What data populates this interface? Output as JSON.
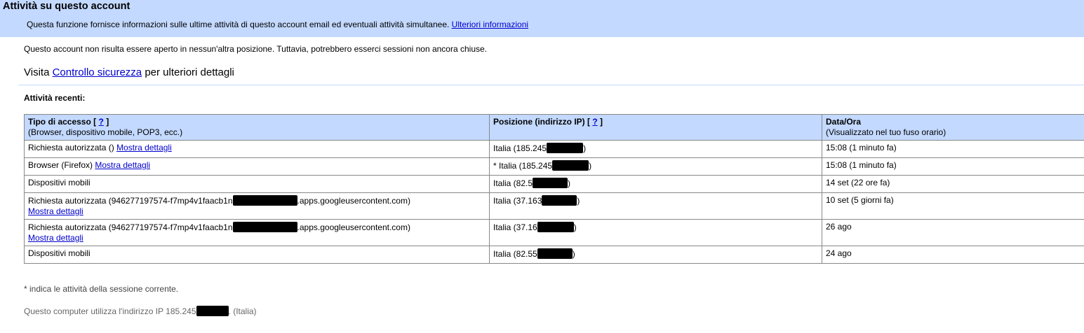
{
  "header": {
    "title": "Attività su questo account",
    "description": "Questa funzione fornisce informazioni sulle ultime attività di questo account email ed eventuali attività simultanee.",
    "more_info_link": "Ulteriori informazioni"
  },
  "notice": "Questo account non risulta essere aperto in nessun'altra posizione. Tuttavia, potrebbero esserci sessioni non ancora chiuse.",
  "visit": {
    "prefix": "Visita",
    "link": "Controllo sicurezza",
    "suffix": "per ulteriori dettagli"
  },
  "recent_heading": "Attività recenti:",
  "table": {
    "col_access": {
      "title": "Tipo di accesso [",
      "help": "?",
      "close": "]",
      "subtitle": "(Browser, dispositivo mobile, POP3, ecc.)"
    },
    "col_location": {
      "title": "Posizione (indirizzo IP) [",
      "help": "?",
      "close": "]"
    },
    "col_datetime": {
      "title": "Data/Ora",
      "subtitle": "(Visualizzato nel tuo fuso orario)"
    },
    "rows": [
      {
        "access_a": "Richiesta autorizzata ()",
        "access_b": "",
        "details_link": "Mostra dettagli",
        "location_prefix": "Italia (185.245",
        "location_suffix": ")",
        "datetime": "15:08 (1 minuto fa)"
      },
      {
        "access_a": "Browser (Firefox)",
        "access_b": "",
        "details_link": "Mostra dettagli",
        "location_prefix": "* Italia (185.245",
        "location_suffix": ")",
        "datetime": "15:08 (1 minuto fa)"
      },
      {
        "access_a": "Dispositivi mobili",
        "access_b": "",
        "details_link": "",
        "location_prefix": "Italia (82.5",
        "location_suffix": ")",
        "datetime": "14 set (22 ore fa)"
      },
      {
        "access_a": "Richiesta autorizzata (946277197574-f7mp4v1faacb1n",
        "access_b": ".apps.googleusercontent.com)",
        "details_link": "Mostra dettagli",
        "location_prefix": "Italia (37.163",
        "location_suffix": ")",
        "datetime": "10 set (5 giorni fa)"
      },
      {
        "access_a": "Richiesta autorizzata (946277197574-f7mp4v1faacb1n",
        "access_b": ".apps.googleusercontent.com)",
        "details_link": "Mostra dettagli",
        "location_prefix": "Italia (37.16",
        "location_suffix": ")",
        "datetime": "26 ago"
      },
      {
        "access_a": "Dispositivi mobili",
        "access_b": "",
        "details_link": "",
        "location_prefix": "Italia (82.55",
        "location_suffix": ")",
        "datetime": "24 ago"
      }
    ]
  },
  "footnote": "* indica le attività della sessione corrente.",
  "ip_note": {
    "prefix": "Questo computer utilizza l'indirizzo IP 185.245",
    "suffix": ". (Italia)"
  }
}
